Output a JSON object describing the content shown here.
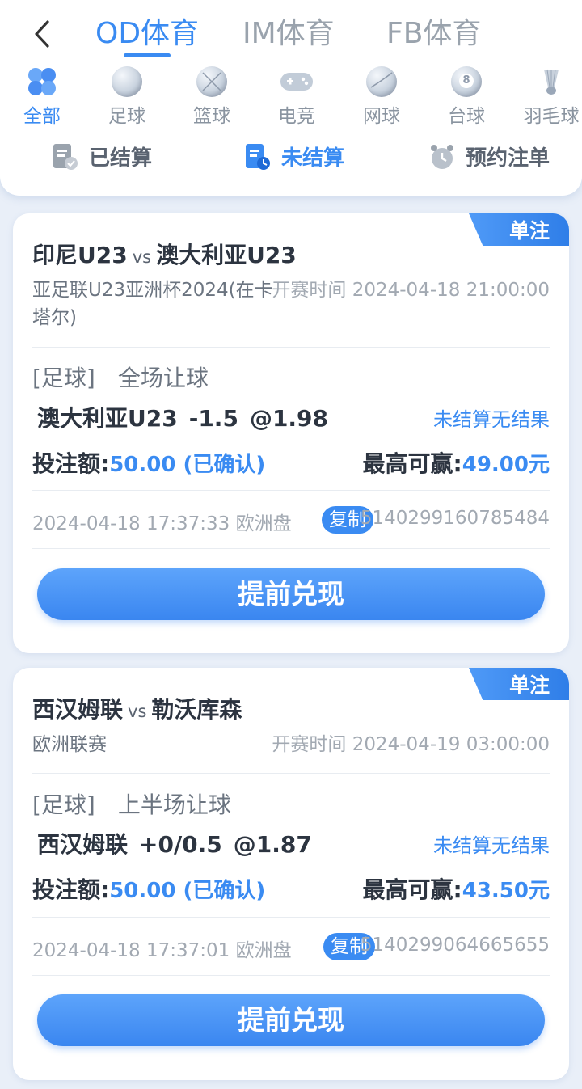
{
  "header": {
    "tabs": [
      {
        "label": "OD体育",
        "active": true
      },
      {
        "label": "IM体育",
        "active": false
      },
      {
        "label": "FB体育",
        "active": false
      }
    ],
    "sports": [
      {
        "label": "全部",
        "icon": "all-icon",
        "active": true
      },
      {
        "label": "足球",
        "icon": "football-icon",
        "active": false
      },
      {
        "label": "篮球",
        "icon": "basketball-icon",
        "active": false
      },
      {
        "label": "电竞",
        "icon": "gamepad-icon",
        "active": false
      },
      {
        "label": "网球",
        "icon": "tennis-icon",
        "active": false
      },
      {
        "label": "台球",
        "icon": "billiards-icon",
        "active": false
      },
      {
        "label": "羽毛球",
        "icon": "badminton-icon",
        "active": false
      }
    ],
    "status": [
      {
        "label": "已结算",
        "icon": "settled-icon",
        "active": false
      },
      {
        "label": "未结算",
        "icon": "unsettled-icon",
        "active": true
      },
      {
        "label": "预约注单",
        "icon": "alarm-clock-icon",
        "active": false
      }
    ]
  },
  "colors": {
    "accent": "#3a8bf2",
    "background": "#e9eff8"
  },
  "bets": [
    {
      "badge": "单注",
      "home": "印尼U23",
      "vs": "vs",
      "away": "澳大利亚U23",
      "league_line1": "亚足联U23亚洲杯2024(在卡",
      "league_line2": "塔尔)",
      "start_time": "开赛时间 2024-04-18 21:00:00",
      "sport": "[足球]",
      "market": "全场让球",
      "pick": "澳大利亚U23",
      "handicap": "-1.5",
      "odds": "@1.98",
      "result": "未结算无结果",
      "stake_label": "投注额:",
      "stake_value": "50.00 (已确认)",
      "max_win_label": "最高可赢:",
      "max_win_value": "49.00元",
      "placed_at": "2024-04-18 17:37:33 欧洲盘",
      "copy_label": "复制",
      "order_no": "5140299160785484",
      "cashout_label": "提前兑现"
    },
    {
      "badge": "单注",
      "home": "西汉姆联",
      "vs": "vs",
      "away": "勒沃库森",
      "league_line1": "欧洲联赛",
      "league_line2": "",
      "start_time": "开赛时间 2024-04-19 03:00:00",
      "sport": "[足球]",
      "market": "上半场让球",
      "pick": "西汉姆联",
      "handicap": "+0/0.5",
      "odds": "@1.87",
      "result": "未结算无结果",
      "stake_label": "投注额:",
      "stake_value": "50.00 (已确认)",
      "max_win_label": "最高可赢:",
      "max_win_value": "43.50元",
      "placed_at": "2024-04-18 17:37:01 欧洲盘",
      "copy_label": "复制",
      "order_no": "5140299064665655",
      "cashout_label": "提前兑现"
    }
  ]
}
